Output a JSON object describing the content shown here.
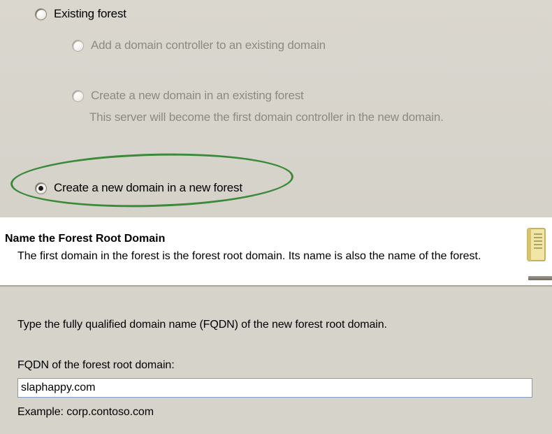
{
  "options": {
    "existing_forest": "Existing forest",
    "add_dc": "Add a domain controller to an existing domain",
    "new_domain_existing_forest": "Create a new domain in an existing forest",
    "new_domain_existing_forest_note": "This server will become the first domain controller in the new domain.",
    "new_domain_new_forest": "Create a new domain in a new forest",
    "selected": "new_domain_new_forest"
  },
  "header": {
    "title": "Name the Forest Root Domain",
    "description": "The first domain in the forest is the forest root domain. Its name is also the name of the forest.",
    "icon": "book-icon"
  },
  "form": {
    "instruction": "Type the fully qualified domain name (FQDN) of the new forest root domain.",
    "fqdn_label": "FQDN of the forest root domain:",
    "fqdn_value": "slaphappy.com",
    "example": "Example: corp.contoso.com"
  },
  "colors": {
    "highlight_ellipse": "#3a8a3a",
    "dialog_background": "#d4d0c8",
    "disabled_text": "#8c8a82"
  }
}
